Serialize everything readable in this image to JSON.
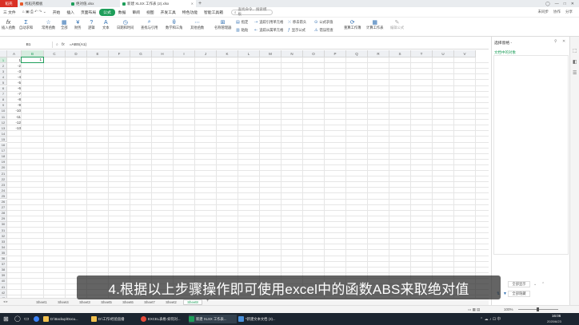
{
  "tabs": [
    {
      "label": "稻壳",
      "color": "#d93025"
    },
    {
      "label": "找稻壳模板",
      "color": "#e65a2c"
    },
    {
      "label": "绝对值.xlsx",
      "color": "#1e9e5a"
    },
    {
      "label": "新建 XLSX 工作表 (2).xlsx",
      "color": "#1e9e5a"
    }
  ],
  "menu": {
    "file": "三 文件",
    "items": [
      "开始",
      "插入",
      "页面布局",
      "公式",
      "数据",
      "审阅",
      "视图",
      "开发工具",
      "特色功能",
      "智能工具箱"
    ],
    "active_index": 3,
    "search": "查找命令、搜索模板",
    "right": [
      "未同步",
      "协作",
      "分享"
    ]
  },
  "ribbon": {
    "big": [
      "插入函数",
      "自动求和",
      "常用函数",
      "全部",
      "财务",
      "逻辑",
      "文本",
      "日期和时间",
      "查找与引用",
      "数学和三角",
      "其他函数",
      "名称管理器"
    ],
    "small_a": [
      "指定",
      "粘贴"
    ],
    "small_b": [
      "追踪引用单元格",
      "追踪从属单元格",
      "移去箭头",
      "显示公式",
      "公式求值",
      "错误检查"
    ],
    "big2": [
      "重算工作簿",
      "计算工作表",
      "编辑公式"
    ]
  },
  "formula_bar": {
    "name_box": "B1",
    "fx": "fx",
    "content": "=ABS(A1)"
  },
  "columns": [
    "A",
    "B",
    "C",
    "D",
    "E",
    "F",
    "G",
    "H",
    "I",
    "J",
    "K",
    "L",
    "M",
    "N",
    "O",
    "P",
    "Q",
    "R",
    "S",
    "T",
    "U",
    "V"
  ],
  "rows": [
    "1",
    "2",
    "3",
    "4",
    "5",
    "6",
    "7",
    "8",
    "9",
    "10",
    "11",
    "12",
    "13",
    "14",
    "15",
    "16",
    "17",
    "18",
    "19",
    "20",
    "21",
    "22",
    "23",
    "24",
    "25",
    "26",
    "27",
    "28",
    "29",
    "30",
    "31",
    "32",
    "33",
    "34",
    "35",
    "36",
    "37",
    "38",
    "39",
    "40",
    "41",
    "42",
    "43",
    "44"
  ],
  "cells_a": [
    "1",
    "-2",
    "-3",
    "-4",
    "-5",
    "-6",
    "-7",
    "-8",
    "-9",
    "-10",
    "-11",
    "-12",
    "-13"
  ],
  "cell_b1": "1",
  "sheets": [
    "Sheet1",
    "Sheet4",
    "Sheet3",
    "Sheet5",
    "Sheet6",
    "Sheet7",
    "Sheet2",
    "Sheet8"
  ],
  "active_sheet": 7,
  "pane": {
    "title": "选择窗格 -",
    "section": "文档中的对象",
    "show_all": "全部显示",
    "hide_all": "全部隐藏"
  },
  "status": {
    "zoom": "100%"
  },
  "subtitle": "4.根据以上步骤操作即可使用excel中的函数ABS来取绝对值",
  "taskbar": {
    "items": [
      "D:\\Backup\\Docu...",
      "D:\\工作\\经验直播",
      "EXCEL表格-如何对...",
      "新建 XLSX 工作表...",
      "*新建文本文档 (3)..."
    ],
    "time": "16:06",
    "date": "2020/6/23"
  },
  "colors": {
    "accent": "#1e9e5a",
    "taskbar": "#1c2530"
  }
}
